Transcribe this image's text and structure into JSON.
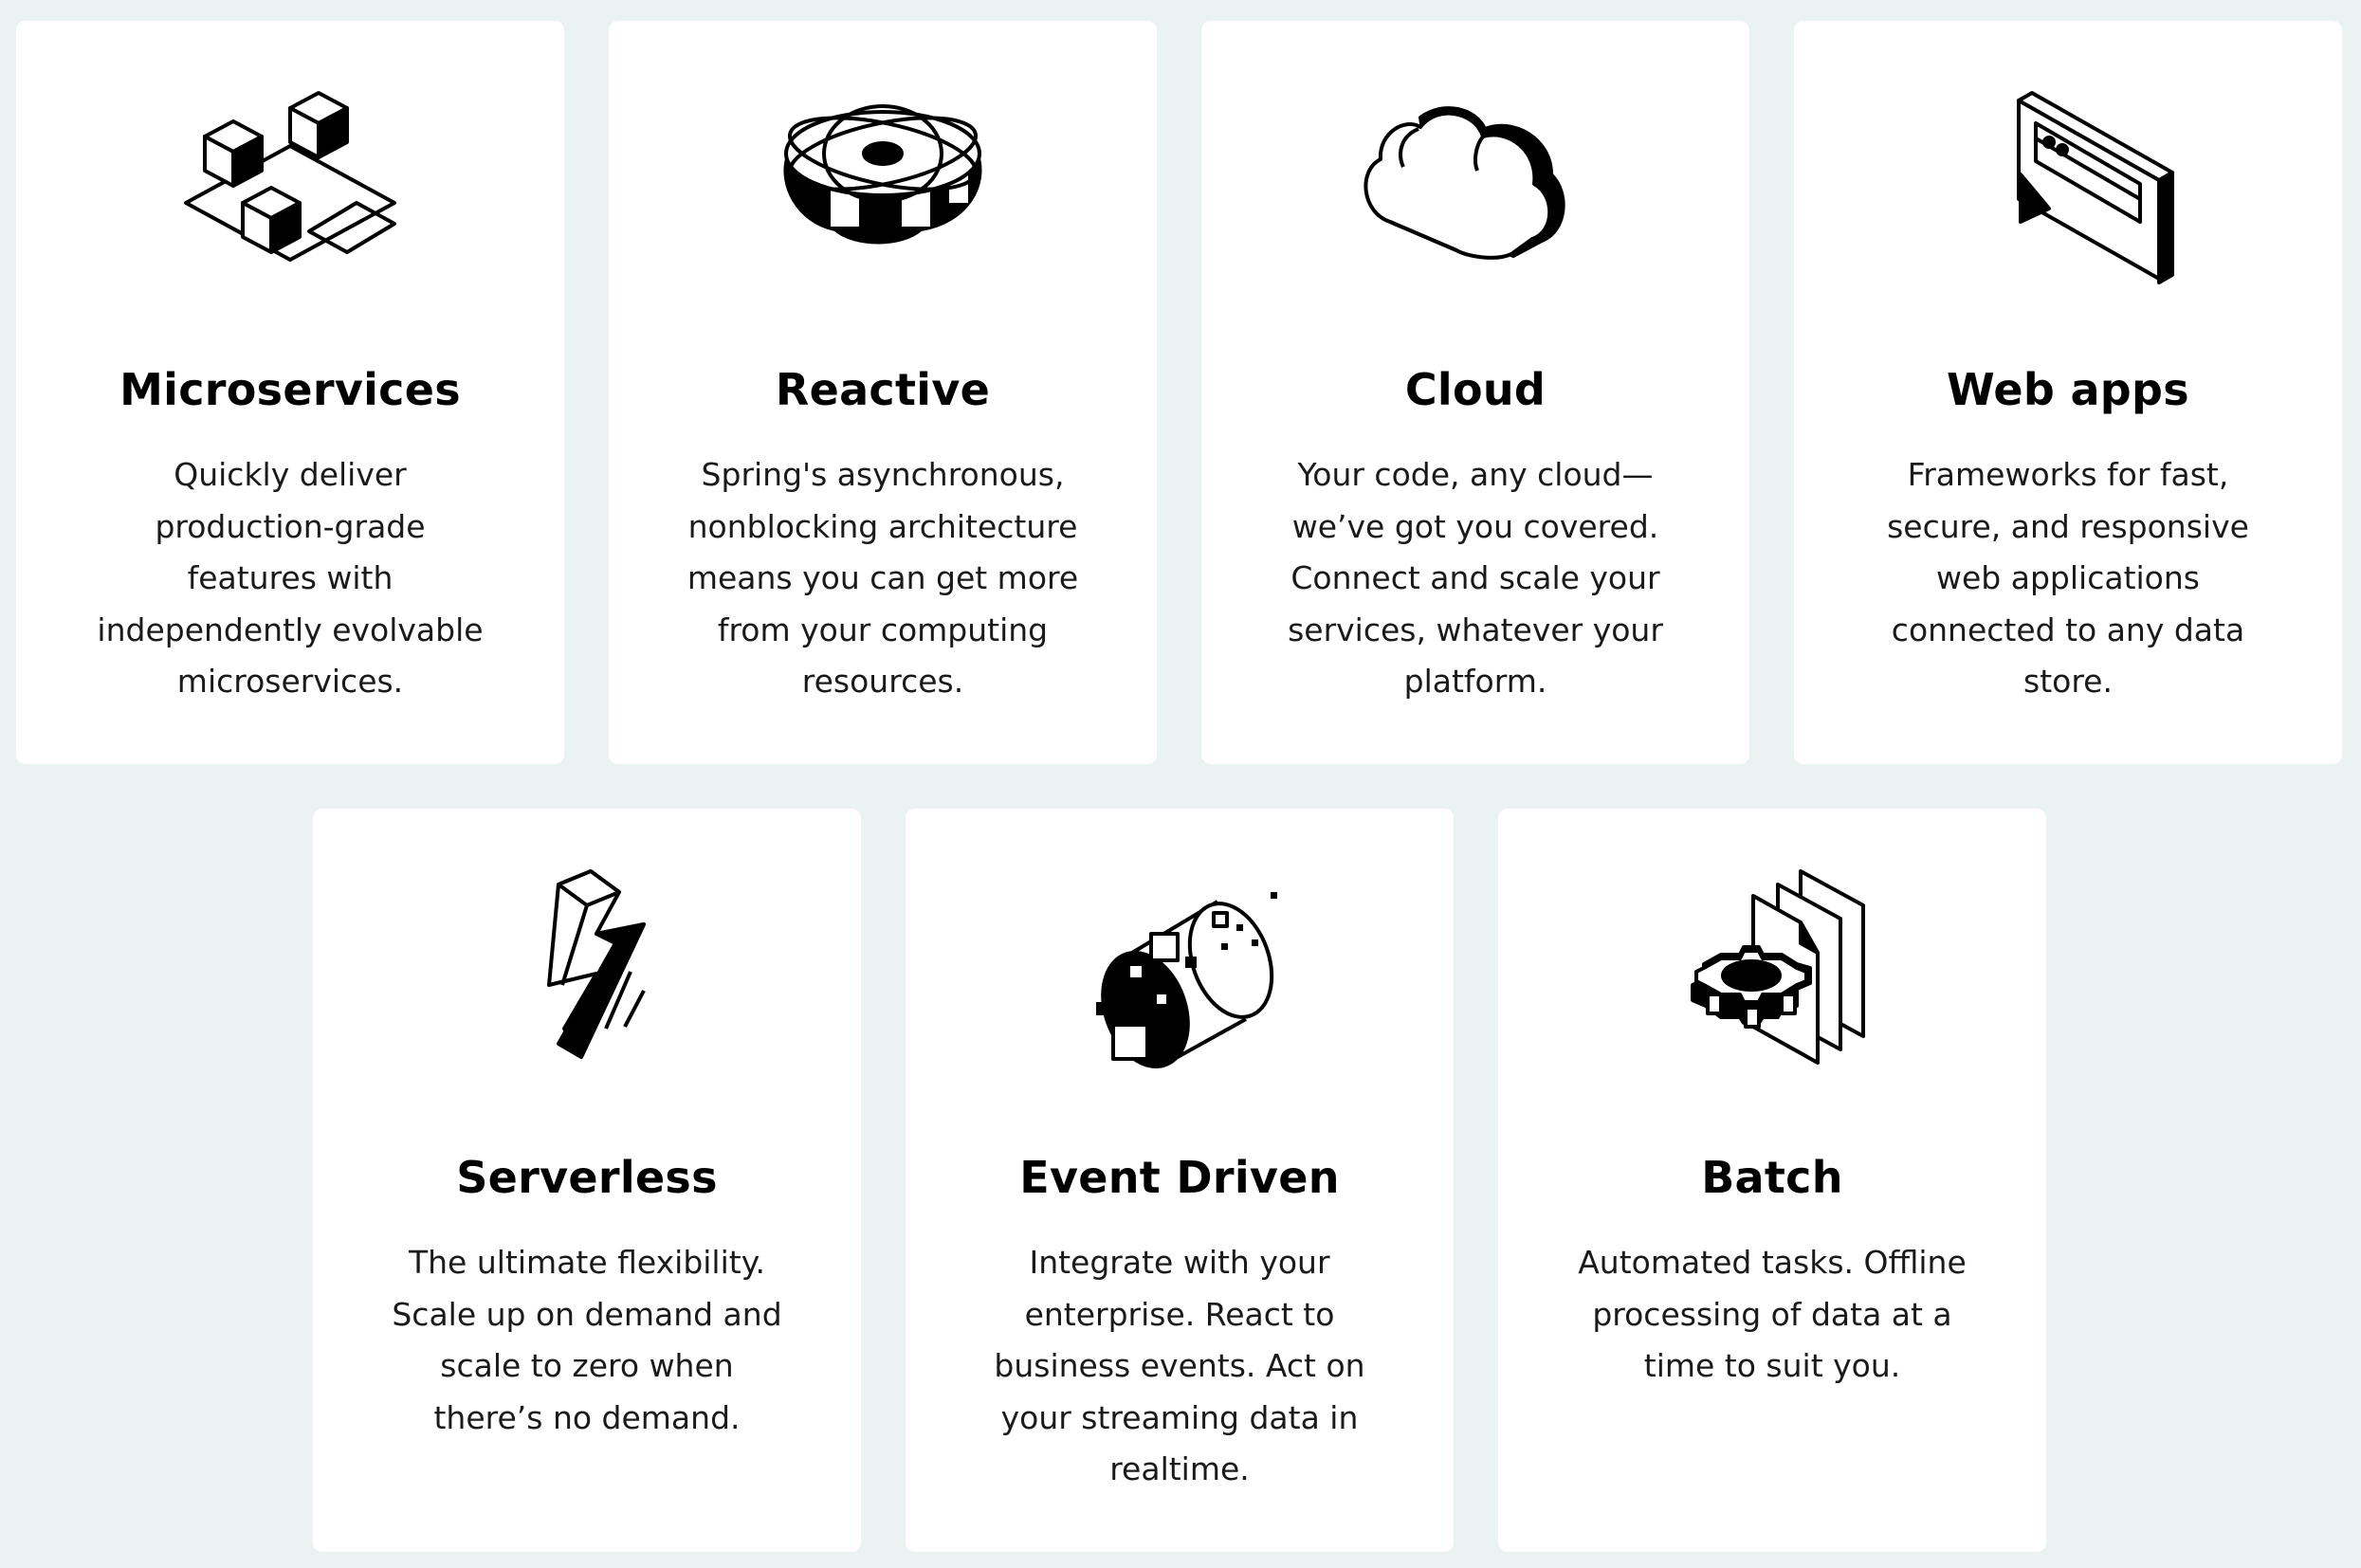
{
  "cards": [
    {
      "icon": "microservices-cubes-icon",
      "title": "Microservices",
      "lines": [
        "Quickly deliver",
        "production-grade",
        "features with",
        "independently evolvable",
        "microservices."
      ]
    },
    {
      "icon": "reactive-atom-icon",
      "title": "Reactive",
      "lines": [
        "Spring's asynchronous,",
        "nonblocking architecture",
        "means you can get more",
        "from your computing",
        "resources."
      ]
    },
    {
      "icon": "cloud-icon",
      "title": "Cloud",
      "lines": [
        "Your code, any cloud—",
        "we’ve got you covered.",
        "Connect and scale your",
        "services, whatever your",
        "platform."
      ]
    },
    {
      "icon": "web-browser-window-icon",
      "title": "Web apps",
      "lines": [
        "Frameworks for fast,",
        "secure, and responsive",
        "web applications",
        "connected to any data",
        "store."
      ]
    },
    {
      "icon": "lightning-bolt-icon",
      "title": "Serverless",
      "lines": [
        "The ultimate flexibility.",
        "Scale up on demand and",
        "scale to zero when",
        "there’s no demand."
      ]
    },
    {
      "icon": "event-stream-cylinder-icon",
      "title": "Event Driven",
      "lines": [
        "Integrate with your",
        "enterprise. React to",
        "business events. Act on",
        "your streaming data in",
        "realtime."
      ]
    },
    {
      "icon": "gear-documents-icon",
      "title": "Batch",
      "lines": [
        "Automated tasks. Offline",
        "processing of data at a",
        "time to suit you."
      ]
    }
  ]
}
